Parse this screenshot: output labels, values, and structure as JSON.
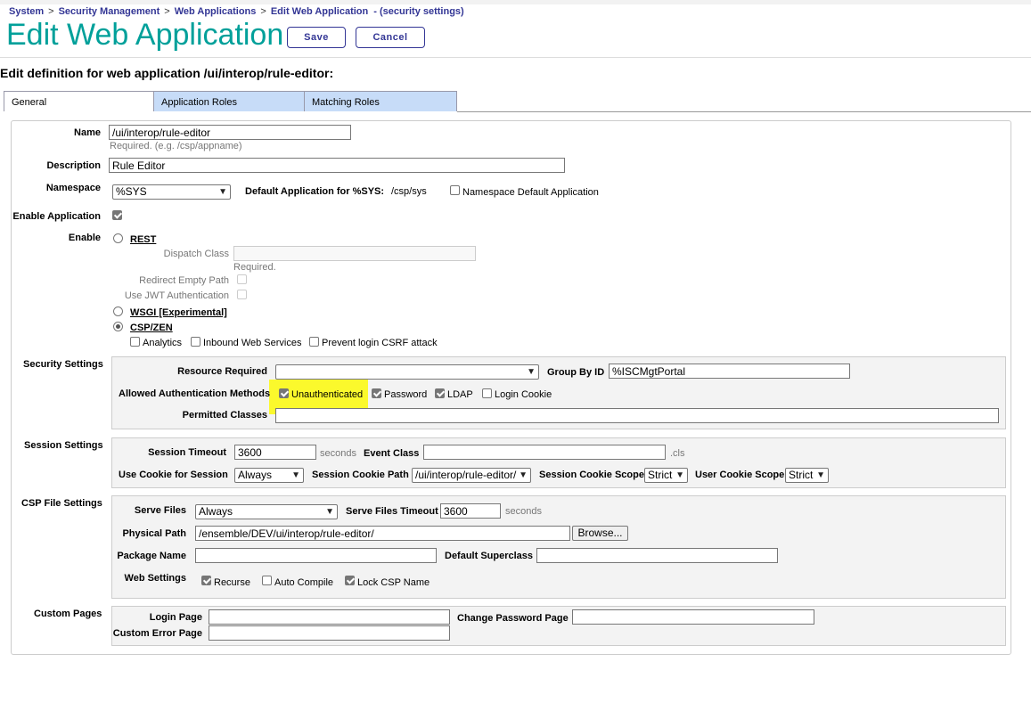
{
  "breadcrumb": {
    "items": [
      "System",
      "Security Management",
      "Web Applications",
      "Edit Web Application"
    ],
    "context": "- (security settings)"
  },
  "page_title": "Edit Web Application",
  "buttons": {
    "save": "Save",
    "cancel": "Cancel"
  },
  "subtitle": "Edit definition for web application /ui/interop/rule-editor:",
  "tabs": [
    "General",
    "Application Roles",
    "Matching Roles"
  ],
  "general": {
    "name": {
      "label": "Name",
      "value": "/ui/interop/rule-editor",
      "hint": "Required. (e.g. /csp/appname)"
    },
    "description": {
      "label": "Description",
      "value": "Rule Editor"
    },
    "namespace": {
      "label": "Namespace",
      "value": "%SYS",
      "default_app_label": "Default Application for %SYS:",
      "default_app_value": "/csp/sys",
      "ns_default_label": "Namespace Default Application",
      "ns_default_checked": false
    },
    "enable_application": {
      "label": "Enable Application",
      "checked": true
    },
    "enable": {
      "label": "Enable",
      "rest": {
        "label": "REST",
        "selected": false,
        "dispatch_class_label": "Dispatch Class",
        "dispatch_class_value": "",
        "required": "Required.",
        "redirect_empty_path_label": "Redirect Empty Path",
        "use_jwt_label": "Use JWT Authentication"
      },
      "wsgi": {
        "label": "WSGI [Experimental]",
        "selected": false
      },
      "csp": {
        "label": "CSP/ZEN",
        "selected": true,
        "options": [
          {
            "label": "Analytics",
            "checked": false
          },
          {
            "label": "Inbound Web Services",
            "checked": false
          },
          {
            "label": "Prevent login CSRF attack",
            "checked": false
          }
        ]
      }
    }
  },
  "security": {
    "section_label": "Security Settings",
    "resource_required_label": "Resource Required",
    "resource_required_value": "",
    "group_by_id_label": "Group By ID",
    "group_by_id_value": "%ISCMgtPortal",
    "auth_methods_label": "Allowed Authentication Methods",
    "auth_methods": [
      {
        "label": "Unauthenticated",
        "checked": true
      },
      {
        "label": "Password",
        "checked": true
      },
      {
        "label": "LDAP",
        "checked": true
      },
      {
        "label": "Login Cookie",
        "checked": false
      }
    ],
    "permitted_classes_label": "Permitted Classes",
    "permitted_classes_value": "",
    "highlight_color": "#fbf92c"
  },
  "session": {
    "section_label": "Session Settings",
    "timeout_label": "Session Timeout",
    "timeout_value": "3600",
    "timeout_unit": "seconds",
    "event_class_label": "Event Class",
    "event_class_value": "",
    "event_class_suffix": ".cls",
    "use_cookie_label": "Use Cookie for Session",
    "use_cookie_value": "Always",
    "cookie_path_label": "Session Cookie Path",
    "cookie_path_value": "/ui/interop/rule-editor/",
    "cookie_scope_label": "Session Cookie Scope",
    "cookie_scope_value": "Strict",
    "user_cookie_scope_label": "User Cookie Scope",
    "user_cookie_scope_value": "Strict"
  },
  "csp_files": {
    "section_label": "CSP File Settings",
    "serve_files_label": "Serve Files",
    "serve_files_value": "Always",
    "serve_timeout_label": "Serve Files Timeout",
    "serve_timeout_value": "3600",
    "serve_timeout_unit": "seconds",
    "physical_path_label": "Physical Path",
    "physical_path_value": "/ensemble/DEV/ui/interop/rule-editor/",
    "browse_label": "Browse...",
    "package_name_label": "Package Name",
    "package_name_value": "",
    "default_superclass_label": "Default Superclass",
    "default_superclass_value": "",
    "web_settings_label": "Web Settings",
    "web_settings": [
      {
        "label": "Recurse",
        "checked": true
      },
      {
        "label": "Auto Compile",
        "checked": false
      },
      {
        "label": "Lock CSP Name",
        "checked": true
      }
    ]
  },
  "custom_pages": {
    "section_label": "Custom Pages",
    "login_page_label": "Login Page",
    "login_page_value": "",
    "change_password_label": "Change Password Page",
    "change_password_value": "",
    "custom_error_label": "Custom Error Page",
    "custom_error_value": ""
  },
  "colors": {
    "brand_title": "#00a09a",
    "link": "#333695",
    "tab_inactive": "#c7dcf8"
  }
}
